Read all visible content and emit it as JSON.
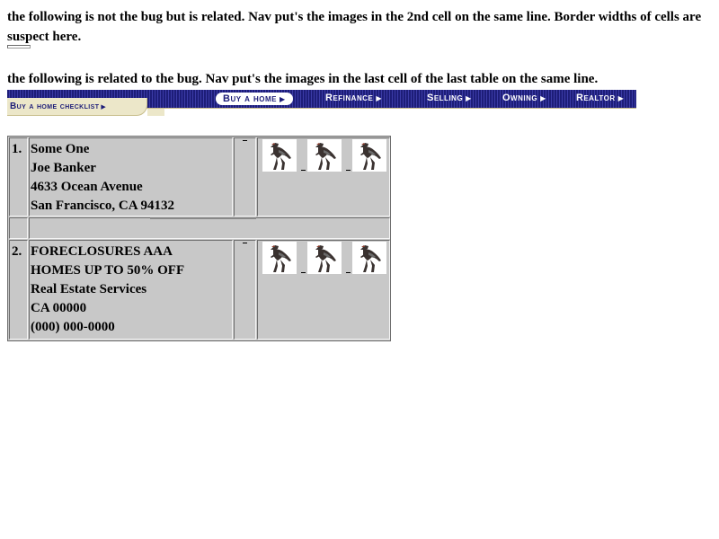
{
  "notes": {
    "first": "the following is not the bug but is related. Nav put's the images in the 2nd cell on the same line. Border widths of cells are suspect here.",
    "second": "the following is related to the bug. Nav put's the images in the last cell of the last table on the same line."
  },
  "navbar": {
    "links": [
      "Buy a home",
      "Refinance",
      "Selling",
      "Owning",
      "Realtor"
    ],
    "active": "Buy a home",
    "checklist": "Buy a home checklist",
    "colors": {
      "bar": "#1d1d78",
      "tab": "#ece7c9"
    }
  },
  "listings": [
    {
      "number": "1.",
      "lines": [
        "Some One",
        "Joe Banker",
        "4633 Ocean Avenue",
        "San Francisco,  CA  94132"
      ],
      "images": [
        "dinosaur-image",
        "dinosaur-image",
        "dinosaur-image"
      ]
    },
    {
      "number": "2.",
      "lines": [
        "FORECLOSURES AAA",
        "HOMES UP TO 50% OFF",
        "Real Estate Services",
        "CA  00000",
        "(000) 000-0000"
      ],
      "images": [
        "dinosaur-image",
        "dinosaur-image",
        "dinosaur-image"
      ]
    }
  ],
  "colors": {
    "cell_bg": "#c8c8c8",
    "border_dark": "#6f6f6f",
    "border_light": "#f4f4f4"
  }
}
